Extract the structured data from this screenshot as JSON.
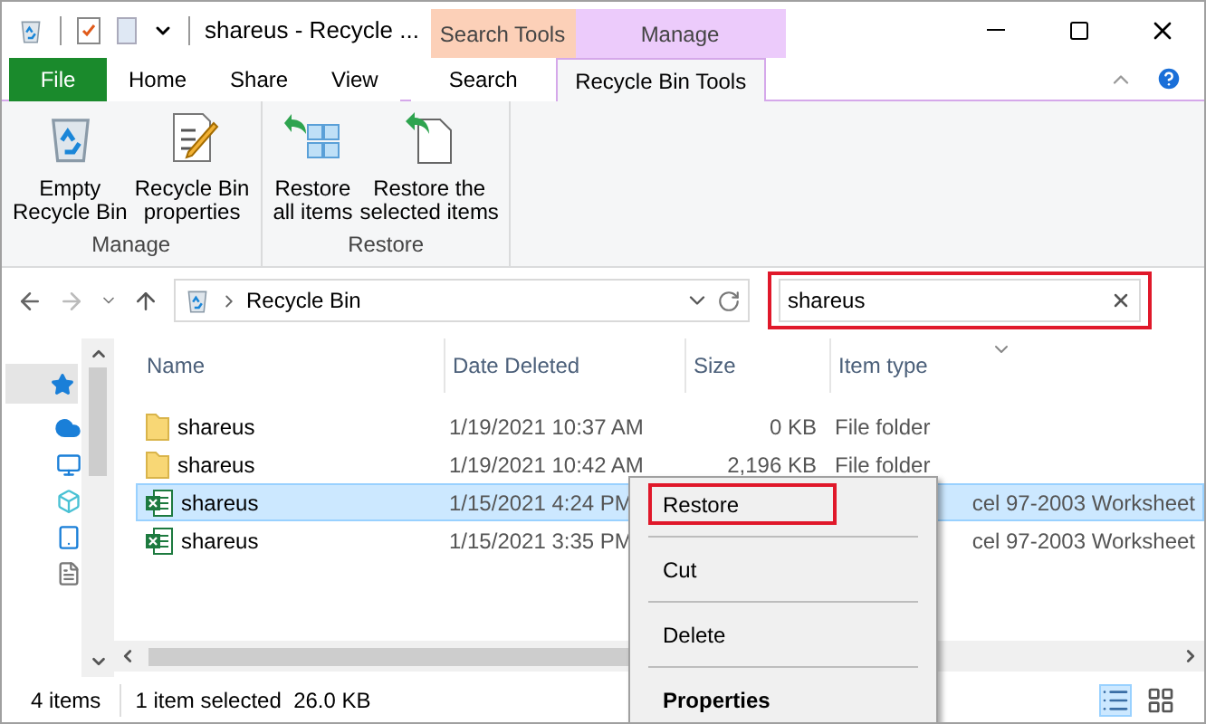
{
  "window": {
    "title": "shareus - Recycle ..."
  },
  "contextual_groups": [
    {
      "label": "Search Tools",
      "color": "#fcd0b8"
    },
    {
      "label": "Manage",
      "color": "#eccbfb"
    }
  ],
  "tabs": [
    {
      "label": "File",
      "kind": "file",
      "selected": false
    },
    {
      "label": "Home",
      "kind": "plain",
      "selected": false
    },
    {
      "label": "Share",
      "kind": "plain",
      "selected": false
    },
    {
      "label": "View",
      "kind": "plain",
      "selected": false
    },
    {
      "label": "Search",
      "kind": "contextual",
      "selected": false
    },
    {
      "label": "Recycle Bin Tools",
      "kind": "contextual",
      "selected": true
    }
  ],
  "ribbon_groups": [
    {
      "label": "Manage",
      "commands": [
        {
          "label": "Empty\nRecycle Bin",
          "kind": "bin"
        },
        {
          "label": "Recycle Bin\nproperties",
          "kind": "props"
        }
      ]
    },
    {
      "label": "Restore",
      "commands": [
        {
          "label": "Restore\nall items",
          "kind": "restore-all"
        },
        {
          "label": "Restore the\nselected items",
          "kind": "restore-one"
        }
      ]
    }
  ],
  "address": {
    "path": "Recycle Bin"
  },
  "search": {
    "value": "shareus",
    "highlighted": true
  },
  "columns": [
    "Name",
    "Date Deleted",
    "Size",
    "Item type"
  ],
  "rows": [
    {
      "name": "shareus",
      "kind": "folder",
      "date": "1/19/2021 10:37 AM",
      "size": "0 KB",
      "type": "File folder",
      "selected": false
    },
    {
      "name": "shareus",
      "kind": "folder",
      "date": "1/19/2021 10:42 AM",
      "size": "2,196 KB",
      "type": "File folder",
      "selected": false
    },
    {
      "name": "shareus",
      "kind": "excel",
      "date": "1/15/2021 4:24 PM",
      "type": "cel 97-2003 Worksheet",
      "selected": true
    },
    {
      "name": "shareus",
      "kind": "excel",
      "date": "1/15/2021 3:35 PM",
      "type": "cel 97-2003 Worksheet",
      "selected": false
    }
  ],
  "context_menu": [
    {
      "label": "Restore",
      "highlighted": true,
      "default": false
    },
    {
      "label": "Cut",
      "highlighted": false,
      "default": false
    },
    {
      "label": "Delete",
      "highlighted": false,
      "default": false
    },
    {
      "label": "Properties",
      "highlighted": false,
      "default": true
    }
  ],
  "status_bar": {
    "count": "4 items",
    "selection": "1 item selected  26.0 KB"
  }
}
